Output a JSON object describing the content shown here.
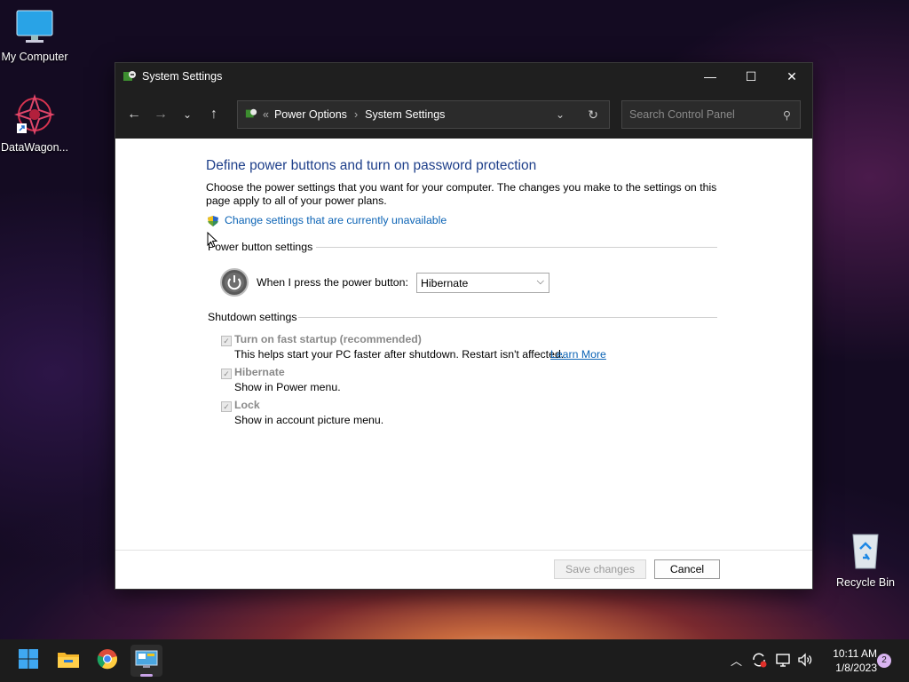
{
  "desktop": {
    "icons": [
      {
        "label": "My Computer"
      },
      {
        "label": "DataWagon..."
      },
      {
        "label": "Recycle Bin"
      }
    ]
  },
  "window": {
    "title": "System Settings",
    "controls": {
      "minimize": "—",
      "maximize": "☐",
      "close": "✕"
    },
    "address": {
      "overflow": "«",
      "crumb1": "Power Options",
      "crumb2": "System Settings"
    },
    "search_placeholder": "Search Control Panel"
  },
  "page": {
    "heading": "Define power buttons and turn on password protection",
    "description": "Choose the power settings that you want for your computer. The changes you make to the settings on this page apply to all of your power plans.",
    "change_link": "Change settings that are currently unavailable",
    "power_group": "Power button settings",
    "power_label": "When I press the power button:",
    "power_value": "Hibernate",
    "shutdown_group": "Shutdown settings",
    "options": [
      {
        "title": "Turn on fast startup (recommended)",
        "desc": "This helps start your PC faster after shutdown. Restart isn't affected.",
        "link": "Learn More",
        "checked": true
      },
      {
        "title": "Hibernate",
        "desc": "Show in Power menu.",
        "checked": true
      },
      {
        "title": "Lock",
        "desc": "Show in account picture menu.",
        "checked": true
      }
    ],
    "save_label": "Save changes",
    "cancel_label": "Cancel"
  },
  "taskbar": {
    "time": "10:11 AM",
    "date": "1/8/2023",
    "notifications": "2"
  },
  "colors": {
    "accent": "#0b63b5",
    "heading": "#1e3f8a"
  }
}
